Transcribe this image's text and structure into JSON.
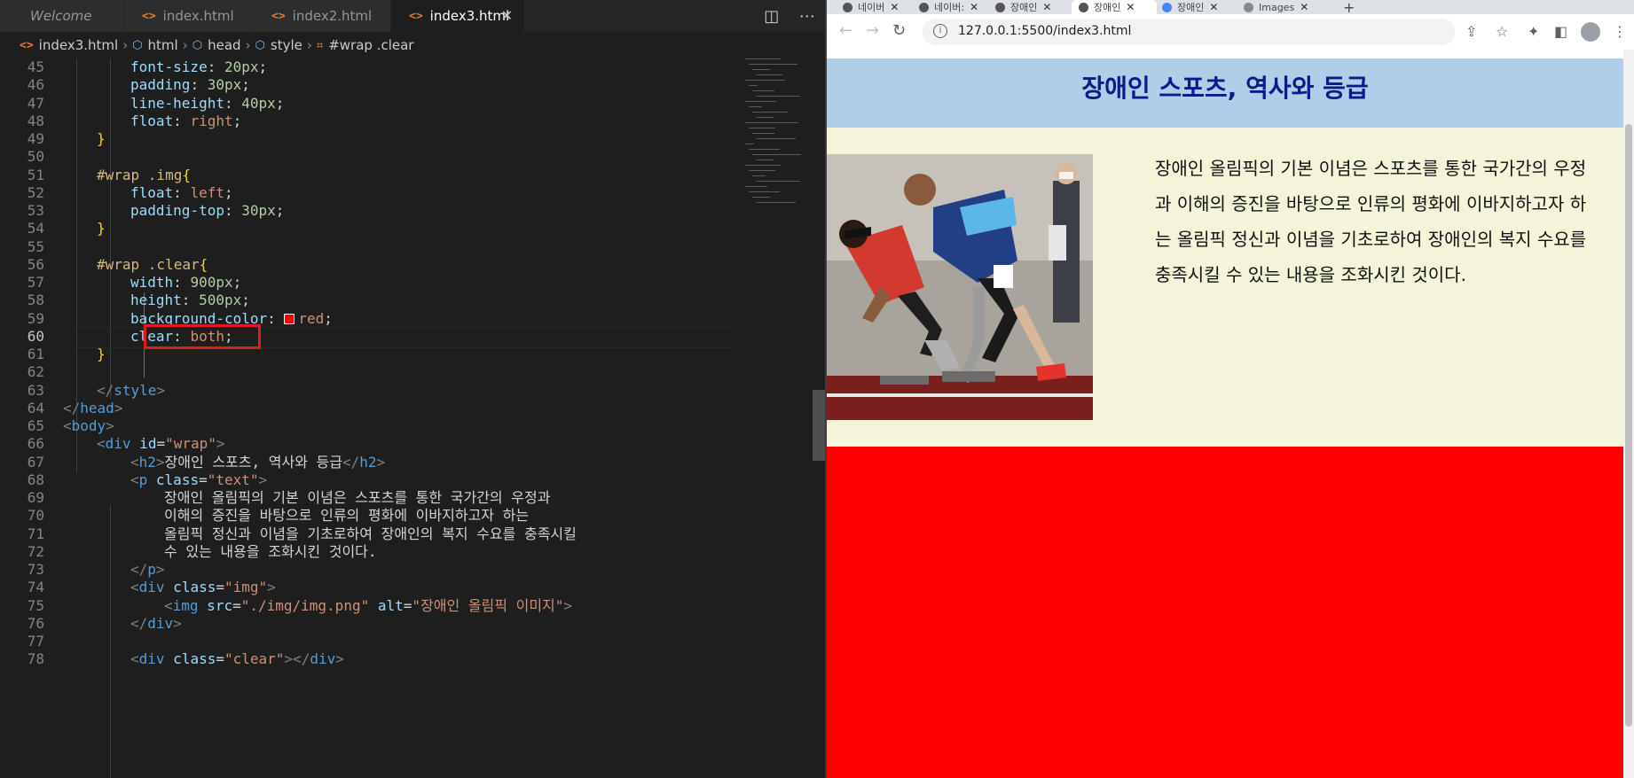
{
  "editor": {
    "tabs": [
      {
        "label": "Welcome",
        "active": false
      },
      {
        "label": "index.html",
        "active": false
      },
      {
        "label": "index2.html",
        "active": false
      },
      {
        "label": "index3.html",
        "active": true
      }
    ],
    "breadcrumb": [
      "index3.html",
      "html",
      "head",
      "style",
      "#wrap .clear"
    ],
    "lines": [
      {
        "n": "45",
        "indent": 2,
        "tokens": [
          {
            "c": "prop",
            "t": "font-size"
          },
          {
            "c": "pun",
            "t": ": "
          },
          {
            "c": "num",
            "t": "20px"
          },
          {
            "c": "pun",
            "t": ";"
          }
        ]
      },
      {
        "n": "46",
        "indent": 2,
        "tokens": [
          {
            "c": "prop",
            "t": "padding"
          },
          {
            "c": "pun",
            "t": ": "
          },
          {
            "c": "num",
            "t": "30px"
          },
          {
            "c": "pun",
            "t": ";"
          }
        ]
      },
      {
        "n": "47",
        "indent": 2,
        "tokens": [
          {
            "c": "prop",
            "t": "line-height"
          },
          {
            "c": "pun",
            "t": ": "
          },
          {
            "c": "num",
            "t": "40px"
          },
          {
            "c": "pun",
            "t": ";"
          }
        ]
      },
      {
        "n": "48",
        "indent": 2,
        "tokens": [
          {
            "c": "prop",
            "t": "float"
          },
          {
            "c": "pun",
            "t": ": "
          },
          {
            "c": "val",
            "t": "right"
          },
          {
            "c": "pun",
            "t": ";"
          }
        ]
      },
      {
        "n": "49",
        "indent": 1,
        "tokens": [
          {
            "c": "brace",
            "t": "}"
          }
        ]
      },
      {
        "n": "50",
        "indent": 0,
        "tokens": []
      },
      {
        "n": "51",
        "indent": 1,
        "tokens": [
          {
            "c": "sel",
            "t": "#wrap .img"
          },
          {
            "c": "brace",
            "t": "{"
          }
        ]
      },
      {
        "n": "52",
        "indent": 2,
        "tokens": [
          {
            "c": "prop",
            "t": "float"
          },
          {
            "c": "pun",
            "t": ": "
          },
          {
            "c": "val",
            "t": "left"
          },
          {
            "c": "pun",
            "t": ";"
          }
        ]
      },
      {
        "n": "53",
        "indent": 2,
        "tokens": [
          {
            "c": "prop",
            "t": "padding-top"
          },
          {
            "c": "pun",
            "t": ": "
          },
          {
            "c": "num",
            "t": "30px"
          },
          {
            "c": "pun",
            "t": ";"
          }
        ]
      },
      {
        "n": "54",
        "indent": 1,
        "tokens": [
          {
            "c": "brace",
            "t": "}"
          }
        ]
      },
      {
        "n": "55",
        "indent": 0,
        "tokens": []
      },
      {
        "n": "56",
        "indent": 1,
        "tokens": [
          {
            "c": "sel",
            "t": "#wrap .clear"
          },
          {
            "c": "brace",
            "t": "{"
          }
        ]
      },
      {
        "n": "57",
        "indent": 2,
        "tokens": [
          {
            "c": "prop",
            "t": "width"
          },
          {
            "c": "pun",
            "t": ": "
          },
          {
            "c": "num",
            "t": "900px"
          },
          {
            "c": "pun",
            "t": ";"
          }
        ]
      },
      {
        "n": "58",
        "indent": 2,
        "tokens": [
          {
            "c": "prop",
            "t": "height"
          },
          {
            "c": "pun",
            "t": ": "
          },
          {
            "c": "num",
            "t": "500px"
          },
          {
            "c": "pun",
            "t": ";"
          }
        ]
      },
      {
        "n": "59",
        "indent": 2,
        "tokens": [
          {
            "c": "prop",
            "t": "background-color"
          },
          {
            "c": "pun",
            "t": ": "
          },
          {
            "c": "swatch",
            "t": ""
          },
          {
            "c": "val",
            "t": "red"
          },
          {
            "c": "pun",
            "t": ";"
          }
        ]
      },
      {
        "n": "60",
        "indent": 2,
        "tokens": [
          {
            "c": "prop",
            "t": "clear"
          },
          {
            "c": "pun",
            "t": ": "
          },
          {
            "c": "val",
            "t": "both"
          },
          {
            "c": "pun",
            "t": ";"
          }
        ]
      },
      {
        "n": "61",
        "indent": 1,
        "tokens": [
          {
            "c": "brace",
            "t": "}"
          }
        ]
      },
      {
        "n": "62",
        "indent": 0,
        "tokens": []
      },
      {
        "n": "63",
        "indent": 1,
        "tokens": [
          {
            "c": "ang",
            "t": "</"
          },
          {
            "c": "tag",
            "t": "style"
          },
          {
            "c": "ang",
            "t": ">"
          }
        ]
      },
      {
        "n": "64",
        "indent": 0,
        "tokens": [
          {
            "c": "ang",
            "t": "</"
          },
          {
            "c": "tag",
            "t": "head"
          },
          {
            "c": "ang",
            "t": ">"
          }
        ]
      },
      {
        "n": "65",
        "indent": 0,
        "tokens": [
          {
            "c": "ang",
            "t": "<"
          },
          {
            "c": "tag",
            "t": "body"
          },
          {
            "c": "ang",
            "t": ">"
          }
        ]
      },
      {
        "n": "66",
        "indent": 1,
        "tokens": [
          {
            "c": "ang",
            "t": "<"
          },
          {
            "c": "tag",
            "t": "div"
          },
          {
            "c": "attr",
            "t": " id"
          },
          {
            "c": "pun",
            "t": "="
          },
          {
            "c": "str",
            "t": "\"wrap\""
          },
          {
            "c": "ang",
            "t": ">"
          }
        ]
      },
      {
        "n": "67",
        "indent": 2,
        "tokens": [
          {
            "c": "ang",
            "t": "<"
          },
          {
            "c": "tag",
            "t": "h2"
          },
          {
            "c": "ang",
            "t": ">"
          },
          {
            "c": "txt",
            "t": "장애인 스포츠, 역사와 등급"
          },
          {
            "c": "ang",
            "t": "</"
          },
          {
            "c": "tag",
            "t": "h2"
          },
          {
            "c": "ang",
            "t": ">"
          }
        ]
      },
      {
        "n": "68",
        "indent": 2,
        "tokens": [
          {
            "c": "ang",
            "t": "<"
          },
          {
            "c": "tag",
            "t": "p"
          },
          {
            "c": "attr",
            "t": " class"
          },
          {
            "c": "pun",
            "t": "="
          },
          {
            "c": "str",
            "t": "\"text\""
          },
          {
            "c": "ang",
            "t": ">"
          }
        ]
      },
      {
        "n": "69",
        "indent": 3,
        "tokens": [
          {
            "c": "txt",
            "t": "장애인 올림픽의 기본 이념은 스포츠를 통한 국가간의 우정과"
          }
        ]
      },
      {
        "n": "70",
        "indent": 3,
        "tokens": [
          {
            "c": "txt",
            "t": "이해의 증진을 바탕으로 인류의 평화에 이바지하고자 하는"
          }
        ]
      },
      {
        "n": "71",
        "indent": 3,
        "tokens": [
          {
            "c": "txt",
            "t": "올림픽 정신과 이념을 기초로하여 장애인의 복지 수요를 충족시킬"
          }
        ]
      },
      {
        "n": "72",
        "indent": 3,
        "tokens": [
          {
            "c": "txt",
            "t": "수 있는 내용을 조화시킨 것이다."
          }
        ]
      },
      {
        "n": "73",
        "indent": 2,
        "tokens": [
          {
            "c": "ang",
            "t": "</"
          },
          {
            "c": "tag",
            "t": "p"
          },
          {
            "c": "ang",
            "t": ">"
          }
        ]
      },
      {
        "n": "74",
        "indent": 2,
        "tokens": [
          {
            "c": "ang",
            "t": "<"
          },
          {
            "c": "tag",
            "t": "div"
          },
          {
            "c": "attr",
            "t": " class"
          },
          {
            "c": "pun",
            "t": "="
          },
          {
            "c": "str",
            "t": "\"img\""
          },
          {
            "c": "ang",
            "t": ">"
          }
        ]
      },
      {
        "n": "75",
        "indent": 3,
        "tokens": [
          {
            "c": "ang",
            "t": "<"
          },
          {
            "c": "tag",
            "t": "img"
          },
          {
            "c": "attr",
            "t": " src"
          },
          {
            "c": "pun",
            "t": "="
          },
          {
            "c": "str",
            "t": "\"./img/img.png\""
          },
          {
            "c": "attr",
            "t": " alt"
          },
          {
            "c": "pun",
            "t": "="
          },
          {
            "c": "str",
            "t": "\"장애인 올림픽 이미지\""
          },
          {
            "c": "ang",
            "t": ">"
          }
        ]
      },
      {
        "n": "76",
        "indent": 2,
        "tokens": [
          {
            "c": "ang",
            "t": "</"
          },
          {
            "c": "tag",
            "t": "div"
          },
          {
            "c": "ang",
            "t": ">"
          }
        ]
      },
      {
        "n": "77",
        "indent": 0,
        "tokens": []
      },
      {
        "n": "78",
        "indent": 2,
        "tokens": [
          {
            "c": "ang",
            "t": "<"
          },
          {
            "c": "tag",
            "t": "div"
          },
          {
            "c": "attr",
            "t": " class"
          },
          {
            "c": "pun",
            "t": "="
          },
          {
            "c": "str",
            "t": "\"clear\""
          },
          {
            "c": "ang",
            "t": "></"
          },
          {
            "c": "tag",
            "t": "div"
          },
          {
            "c": "ang",
            "t": ">"
          }
        ]
      }
    ]
  },
  "browser": {
    "tabs": [
      {
        "label": "네이버",
        "active": false
      },
      {
        "label": "네이버:",
        "active": false
      },
      {
        "label": "장애인",
        "active": false
      },
      {
        "label": "장애인",
        "active": true
      },
      {
        "label": "장애인",
        "active": false
      },
      {
        "label": "Images",
        "active": false
      }
    ],
    "url": "127.0.0.1:5500/index3.html",
    "page": {
      "heading": "장애인 스포츠, 역사와 등급",
      "paragraph": "장애인 올림픽의 기본 이념은 스포츠를 통한 국가간의 우정과 이해의 증진을 바탕으로 인류의 평화에 이바지하고자 하는 올림픽 정신과 이념을 기초로하여 장애인의 복지 수요를 충족시킬 수 있는 내용을 조화시킨 것이다.",
      "image_alt": "장애인 올림픽 이미지",
      "colors": {
        "heading_bg": "#b0cee8",
        "heading_text": "#0a1b8c",
        "content_bg": "#f4f4d9",
        "clear_bg": "#ff0000"
      }
    }
  }
}
